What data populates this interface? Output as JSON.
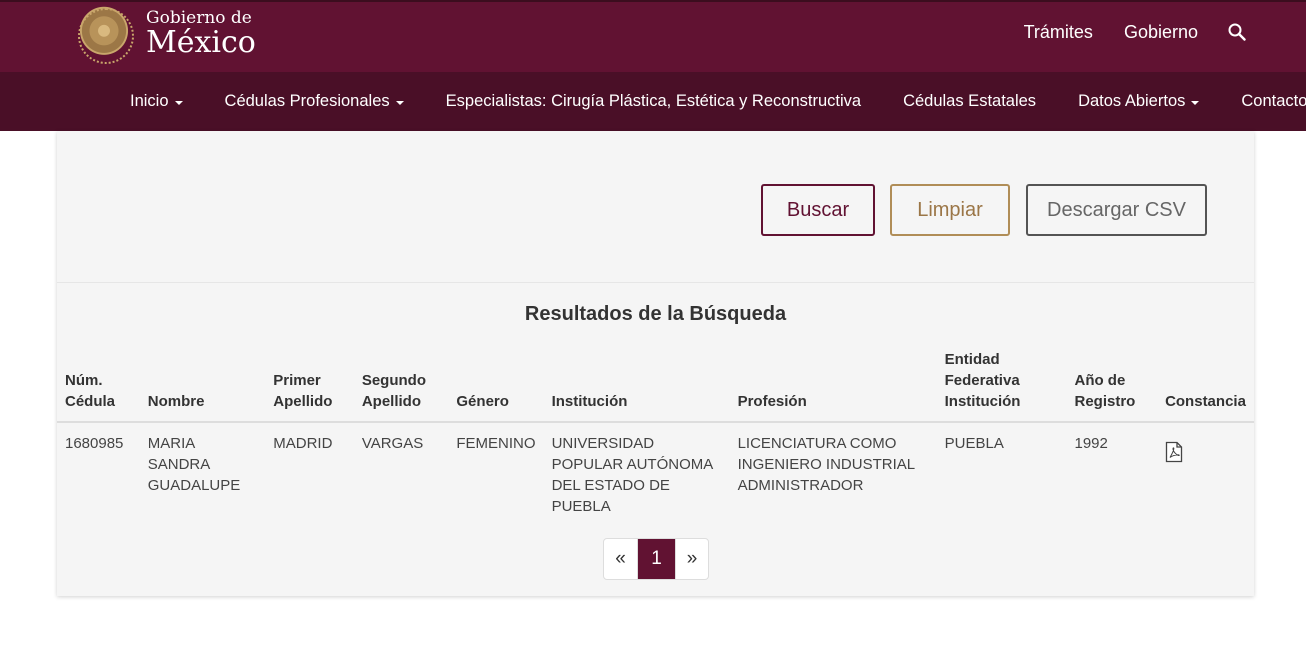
{
  "header": {
    "logo_small": "Gobierno de",
    "logo_big": "México",
    "nav": [
      "Trámites",
      "Gobierno"
    ],
    "search_icon": "search-icon"
  },
  "subnav": {
    "items": [
      {
        "label": "Inicio",
        "dropdown": true
      },
      {
        "label": "Cédulas Profesionales",
        "dropdown": true
      },
      {
        "label": "Especialistas: Cirugía Plástica, Estética y Reconstructiva",
        "dropdown": false
      },
      {
        "label": "Cédulas Estatales",
        "dropdown": false
      },
      {
        "label": "Datos Abiertos",
        "dropdown": true
      },
      {
        "label": "Contacto",
        "dropdown": false
      }
    ]
  },
  "actions": {
    "buscar": "Buscar",
    "limpiar": "Limpiar",
    "csv": "Descargar CSV"
  },
  "results": {
    "title": "Resultados de la Búsqueda",
    "columns": [
      "Núm. Cédula",
      "Nombre",
      "Primer Apellido",
      "Segundo Apellido",
      "Género",
      "Institución",
      "Profesión",
      "Entidad Federativa Institución",
      "Año de Registro",
      "Constancia"
    ],
    "rows": [
      {
        "cedula": "1680985",
        "nombre": "MARIA SANDRA GUADALUPE",
        "primer_apellido": "MADRID",
        "segundo_apellido": "VARGAS",
        "genero": "FEMENINO",
        "institucion": "UNIVERSIDAD POPULAR AUTÓNOMA DEL ESTADO DE PUEBLA",
        "profesion": "LICENCIATURA COMO INGENIERO INDUSTRIAL ADMINISTRADOR",
        "entidad": "PUEBLA",
        "anio": "1992",
        "constancia_icon": "pdf-icon"
      }
    ]
  },
  "pagination": {
    "prev": "«",
    "current": "1",
    "next": "»"
  },
  "colors": {
    "header": "#611232",
    "subnav": "#4a0f27",
    "gold": "#b08d57"
  }
}
